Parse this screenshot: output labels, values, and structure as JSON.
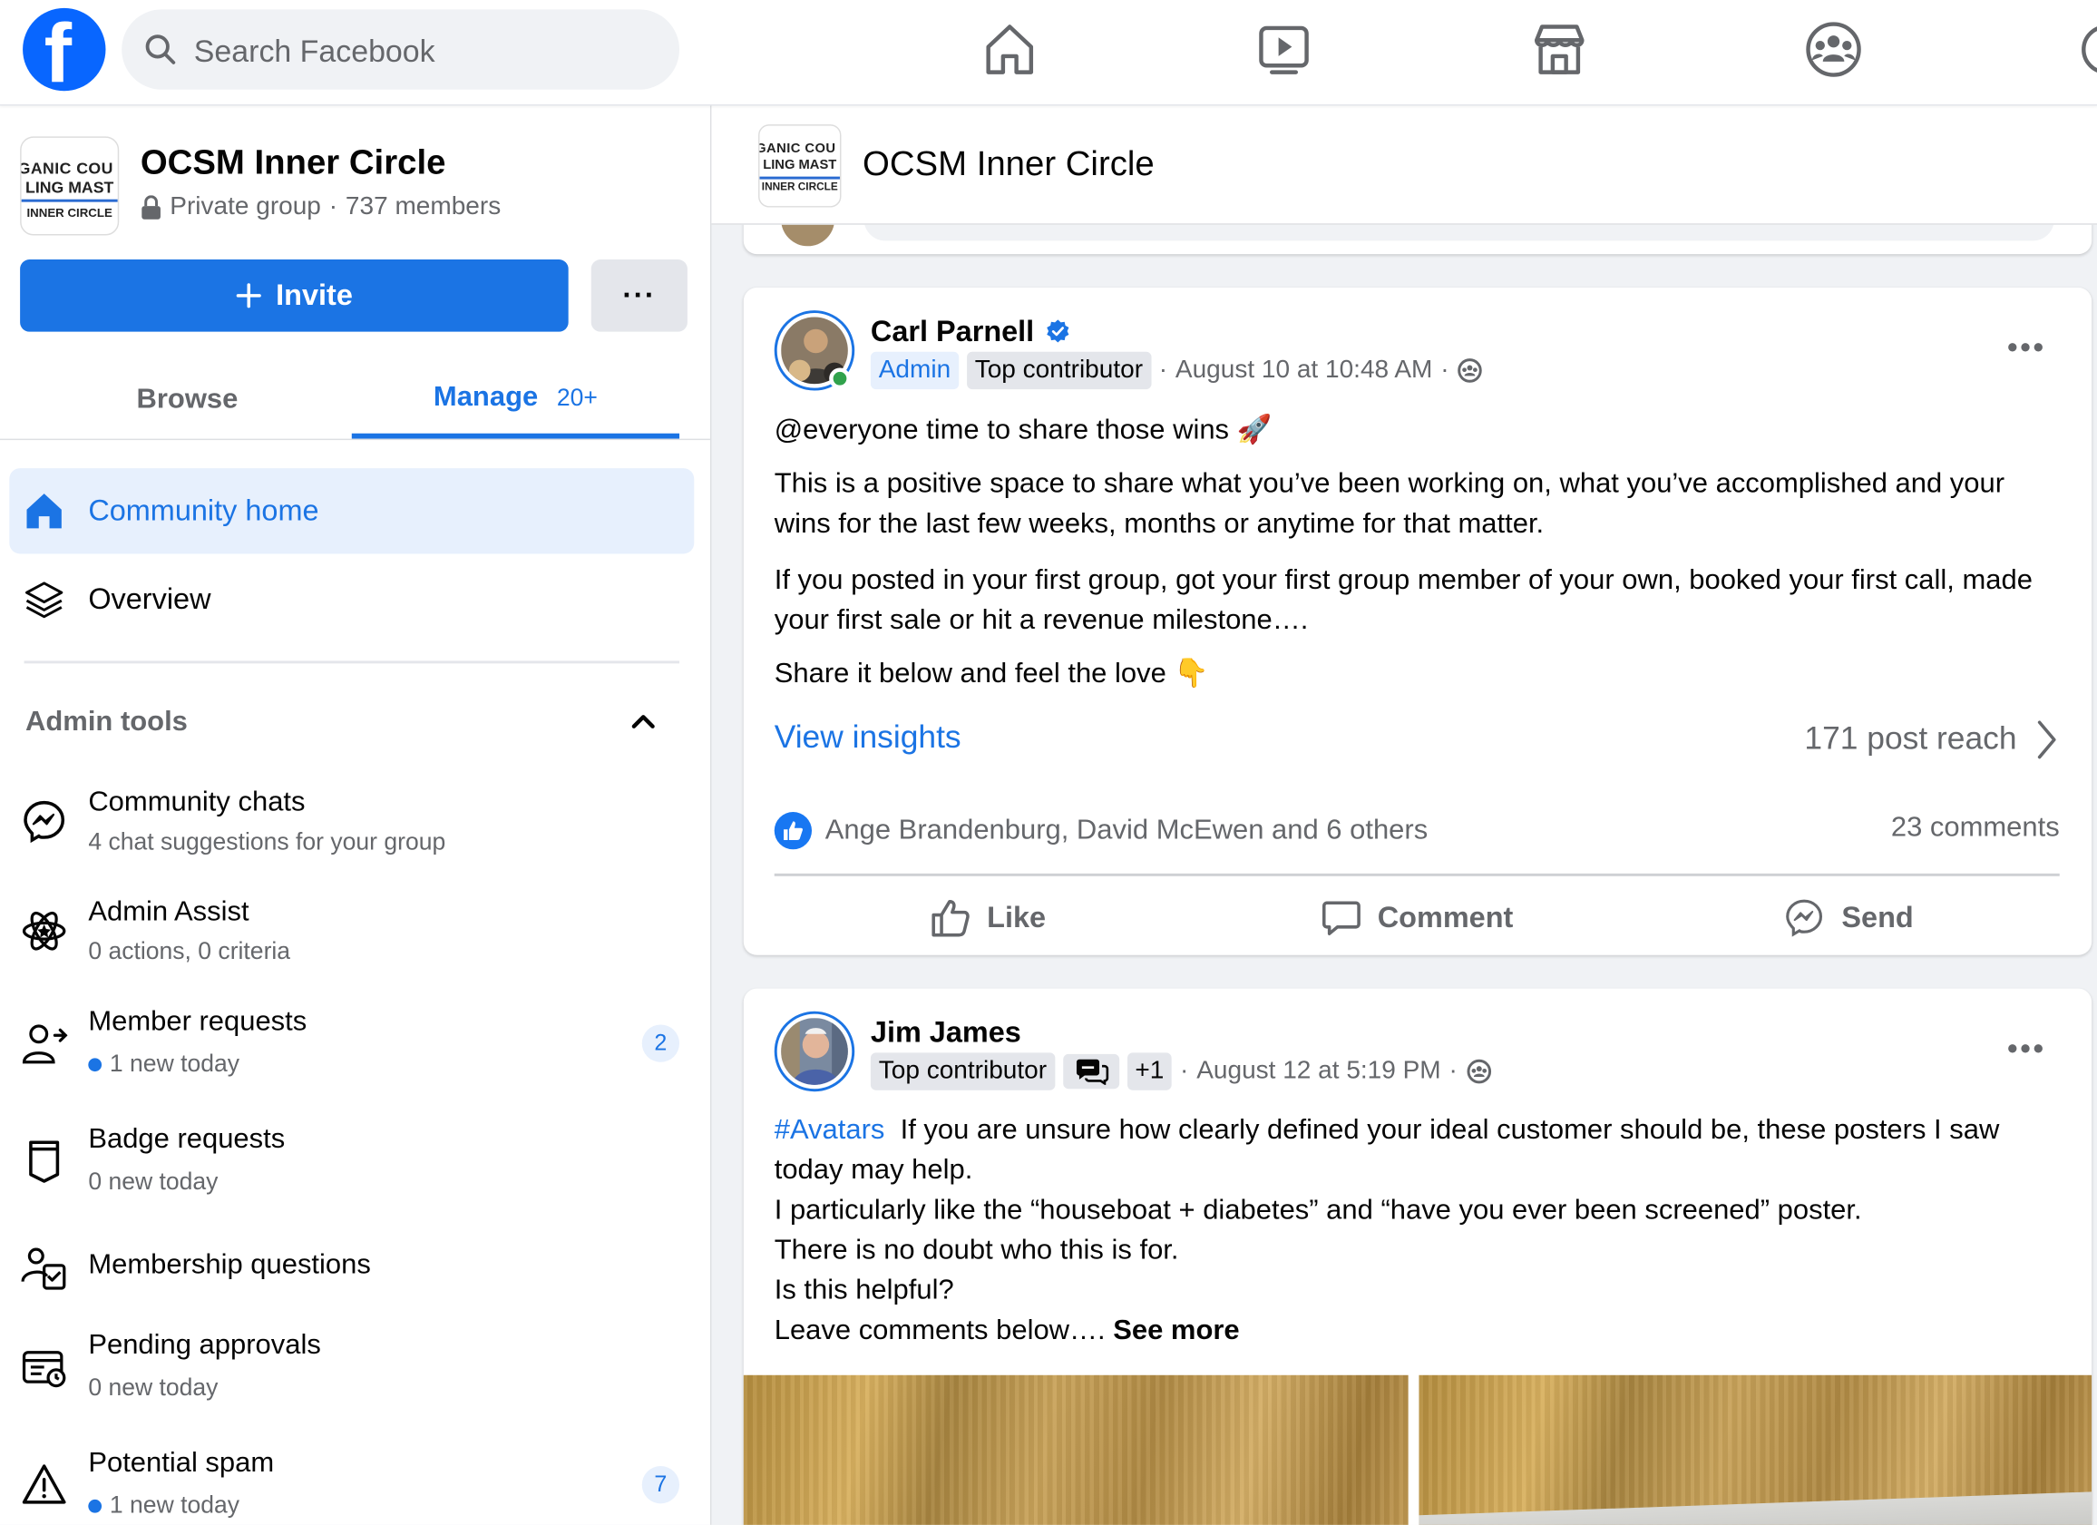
{
  "topbar": {
    "search_placeholder": "Search Facebook",
    "nav_icons": [
      "home-icon",
      "watch-icon",
      "marketplace-icon",
      "groups-icon"
    ]
  },
  "group": {
    "name": "OCSM Inner Circle",
    "privacy": "Private group",
    "separator": "·",
    "members": "737 members",
    "logo_lines": [
      "GANIC COU",
      "LING MAST",
      "INNER CIRCLE"
    ]
  },
  "sidebar": {
    "invite_label": "Invite",
    "more_label": "···",
    "tabs": [
      {
        "label": "Browse"
      },
      {
        "label": "Manage",
        "count": "20+"
      }
    ],
    "nav": [
      {
        "label": "Community home",
        "icon": "home-icon",
        "active": true
      },
      {
        "label": "Overview",
        "icon": "layers-icon",
        "active": false
      }
    ],
    "admin_tools_title": "Admin tools",
    "tools": [
      {
        "title": "Community chats",
        "sub": "4 chat suggestions for your group",
        "icon": "messenger-icon"
      },
      {
        "title": "Admin Assist",
        "sub": "0 actions, 0 criteria",
        "icon": "admin-assist-icon"
      },
      {
        "title": "Member requests",
        "sub": "1 new today",
        "icon": "member-requests-icon",
        "badge": "2",
        "dot": true
      },
      {
        "title": "Badge requests",
        "sub": "0 new today",
        "icon": "badge-icon"
      },
      {
        "title": "Membership questions",
        "sub": "",
        "icon": "membership-questions-icon"
      },
      {
        "title": "Pending approvals",
        "sub": "0 new today",
        "icon": "pending-approvals-icon"
      },
      {
        "title": "Potential spam",
        "sub": "1 new today",
        "icon": "warning-icon",
        "badge": "7",
        "dot": true
      }
    ]
  },
  "main": {
    "header_title": "OCSM Inner Circle",
    "posts": [
      {
        "author": "Carl Parnell",
        "tags": [
          "Admin",
          "Top contributor"
        ],
        "timestamp": "August 10 at 10:48 AM",
        "separator": "·",
        "paragraphs": [
          "@everyone time to share those wins 🚀",
          "This is a positive space to share what you’ve been working on, what you’ve accomplished and your wins for the last few weeks, months or anytime for that matter.",
          "If you posted in your first group, got your first group member of your own, booked your first call, made your first sale or hit a revenue milestone….",
          "Share it below and feel the love 👇"
        ],
        "insights_label": "View insights",
        "reach": "171 post reach",
        "reactions": "Ange Brandenburg, David McEwen and 6 others",
        "comments": "23 comments",
        "actions": [
          "Like",
          "Comment",
          "Send"
        ]
      },
      {
        "author": "Jim James",
        "tags": [
          "Top contributor"
        ],
        "extra_badge": "+1",
        "timestamp": "August 12 at 5:19 PM",
        "separator": "·",
        "hashtag": "#Avatars",
        "lines": [
          "If you are unsure how clearly defined your ideal customer should be, these posters I saw today may help.",
          "I particularly like the “houseboat + diabetes” and “have you ever been screened” poster.",
          "There is no doubt who this is for.",
          "Is this helpful?",
          "Leave comments below…."
        ],
        "see_more": "See more"
      }
    ]
  },
  "colors": {
    "brand": "#0866ff",
    "accent": "#1b74e4",
    "secondary_text": "#65676b",
    "online": "#31a24c"
  }
}
